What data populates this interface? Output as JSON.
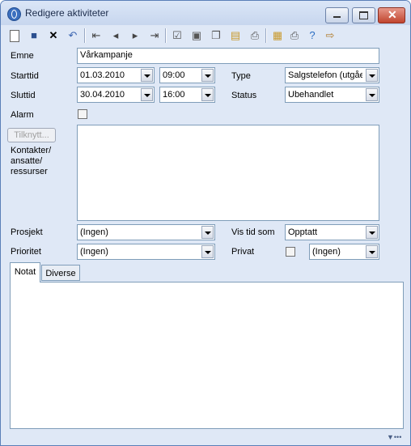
{
  "window": {
    "title": "Redigere aktiviteter"
  },
  "toolbar": {
    "icons": [
      "new-icon",
      "save-icon",
      "delete-icon",
      "undo-icon",
      "first-record-icon",
      "previous-icon",
      "next-icon",
      "last-record-icon",
      "mark-done-icon",
      "card-icon",
      "copy-icon",
      "paste-icon",
      "print-icon",
      "properties-icon",
      "print-setup-icon",
      "help-icon",
      "exit-icon"
    ]
  },
  "form": {
    "subject_label": "Emne",
    "subject_value": "Vårkampanje",
    "start_label": "Starttid",
    "start_date": "01.03.2010",
    "start_time": "09:00",
    "type_label": "Type",
    "type_value": "Salgstelefon (utgående)",
    "end_label": "Sluttid",
    "end_date": "30.04.2010",
    "end_time": "16:00",
    "status_label": "Status",
    "status_value": "Ubehandlet",
    "alarm_label": "Alarm",
    "connect_button": "Tilknytt...",
    "contacts_label_1": "Kontakter/",
    "contacts_label_2": "ansatte/",
    "contacts_label_3": "ressurser",
    "project_label": "Prosjekt",
    "project_value": "(Ingen)",
    "showtime_label": "Vis tid som",
    "showtime_value": "Opptatt",
    "priority_label": "Prioritet",
    "priority_value": "(Ingen)",
    "private_label": "Privat",
    "private_value": "(Ingen)"
  },
  "tabs": [
    "Notat",
    "Diverse"
  ],
  "status": {
    "grip": "▼•••"
  }
}
